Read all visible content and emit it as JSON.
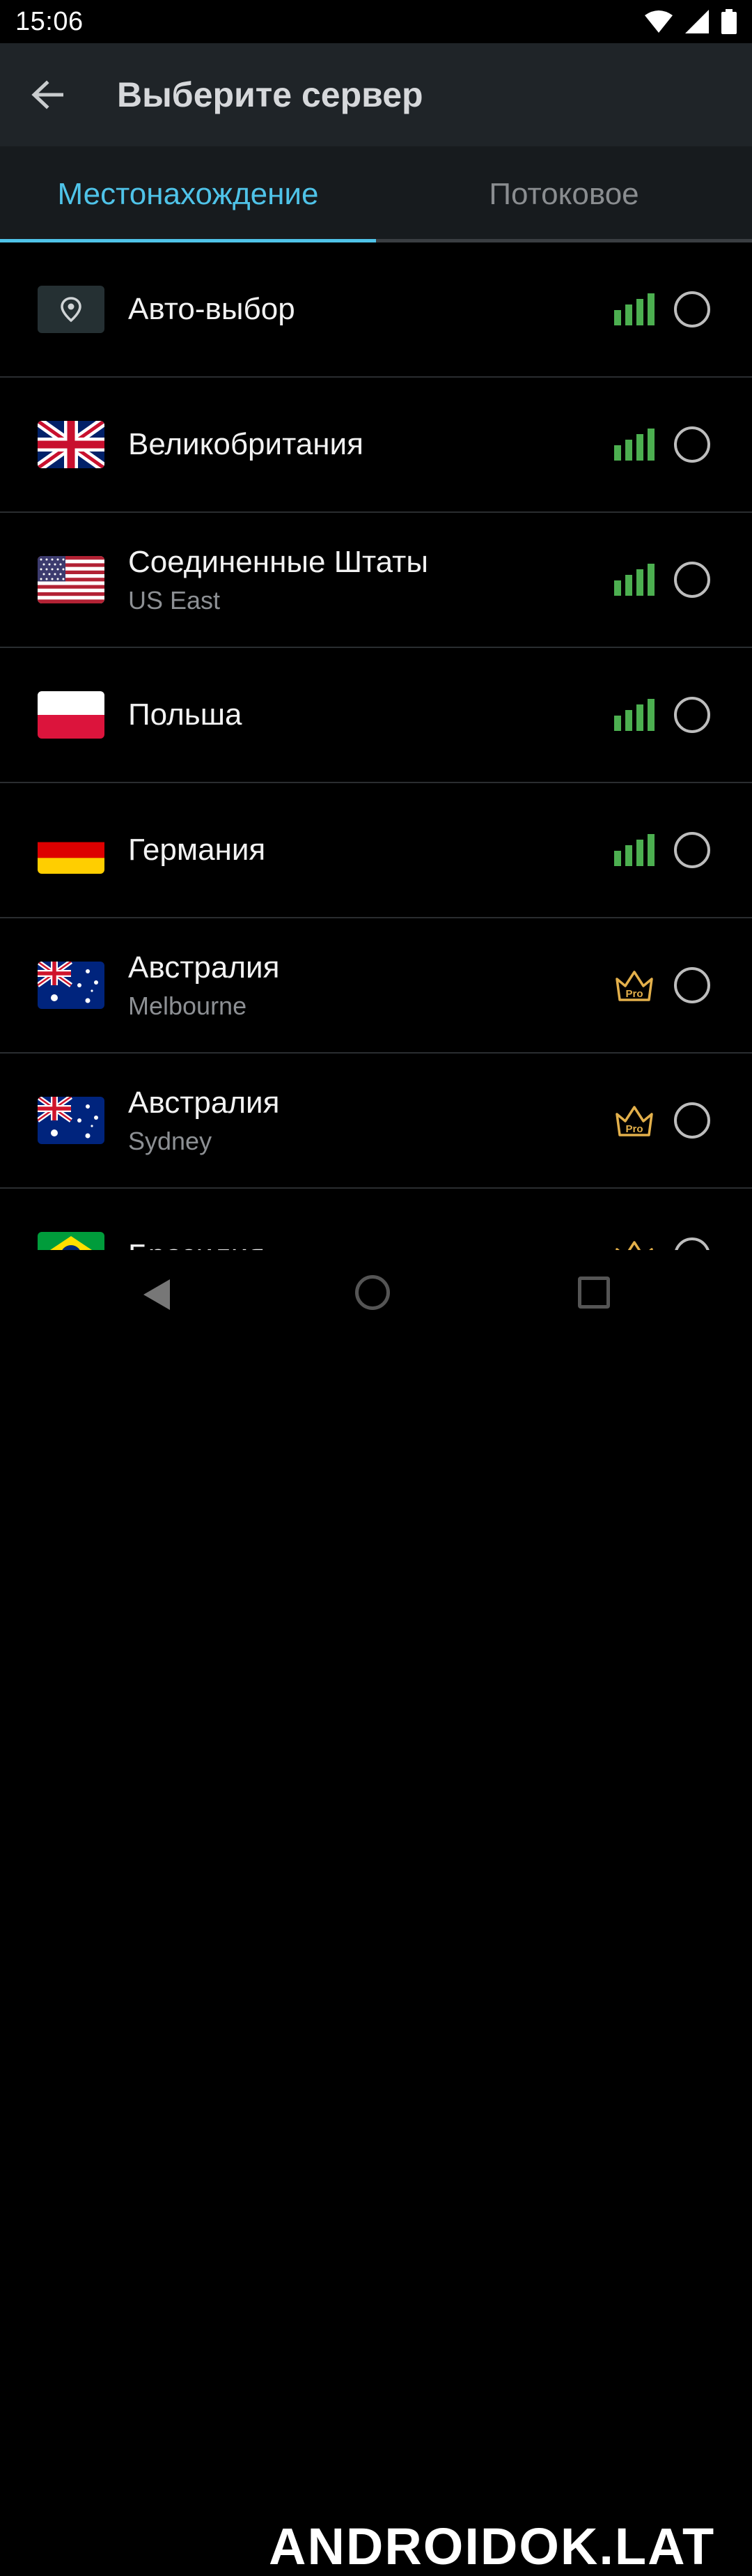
{
  "status": {
    "time": "15:06"
  },
  "appbar": {
    "title": "Выберите сервер"
  },
  "tabs": [
    {
      "label": "Местонахождение",
      "active": true
    },
    {
      "label": "Потоковое",
      "active": false
    }
  ],
  "servers": [
    {
      "name": "Авто-выбор",
      "sub": "",
      "flag": "auto-location-icon",
      "tier": "signal"
    },
    {
      "name": "Великобритания",
      "sub": "",
      "flag": "uk-flag-icon",
      "tier": "signal"
    },
    {
      "name": "Соединенные Штаты",
      "sub": "US East",
      "flag": "us-flag-icon",
      "tier": "signal"
    },
    {
      "name": "Польша",
      "sub": "",
      "flag": "poland-flag-icon",
      "tier": "signal"
    },
    {
      "name": "Германия",
      "sub": "",
      "flag": "germany-flag-icon",
      "tier": "signal"
    },
    {
      "name": "Австралия",
      "sub": "Melbourne",
      "flag": "australia-flag-icon",
      "tier": "pro"
    },
    {
      "name": "Австралия",
      "sub": "Sydney",
      "flag": "australia-flag-icon",
      "tier": "pro"
    },
    {
      "name": "Бразилия",
      "sub": "",
      "flag": "brazil-flag-icon",
      "tier": "pro"
    }
  ],
  "badges": {
    "pro": "Pro"
  },
  "watermark": "ANDROIDOK.LAT",
  "colors": {
    "accent": "#4fc3e8",
    "signal": "#4caf50",
    "pro": "#e3b04b"
  }
}
